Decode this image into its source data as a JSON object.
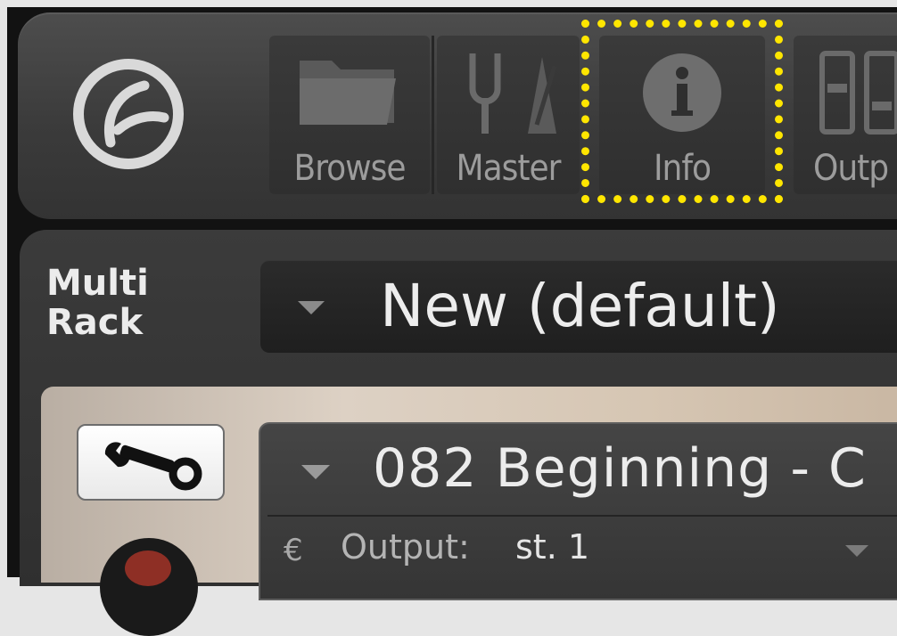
{
  "toolbar": {
    "browse_label": "Browse",
    "master_label": "Master",
    "info_label": "Info",
    "outputs_label": "Outp"
  },
  "rack": {
    "title_line1": "Multi",
    "title_line2": "Rack",
    "preset_name": "New (default)"
  },
  "instrument": {
    "name": "082 Beginning - C",
    "output_label": "Output:",
    "output_value": "st. 1"
  },
  "icons": {
    "logo": "kontakt-logo-icon",
    "browse": "folder-icon",
    "master": "tuning-fork-metronome-icon",
    "info": "info-icon",
    "outputs": "faders-icon",
    "wrench": "wrench-icon",
    "output": "output-icon"
  },
  "colors": {
    "highlight": "#ffe600",
    "toolbar_bg": "#404040",
    "text_primary": "#ececec",
    "text_secondary": "#9c9c9c"
  }
}
